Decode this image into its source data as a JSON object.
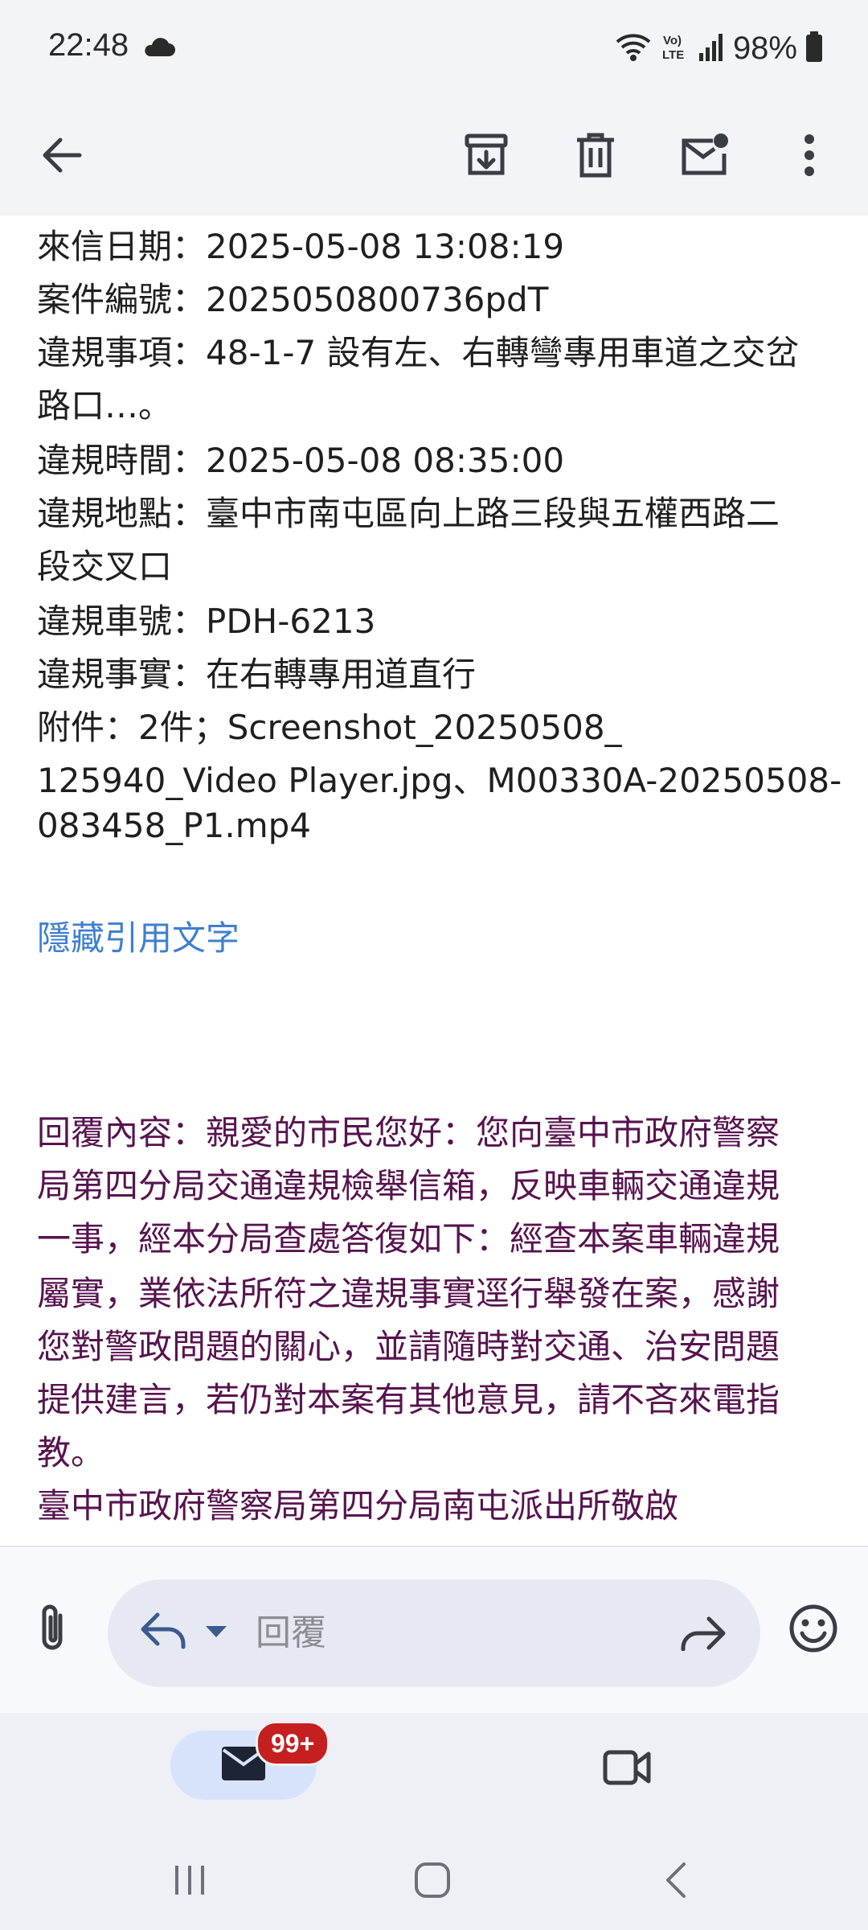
{
  "status_bar": {
    "time": "22:48",
    "battery": "98%",
    "icons": [
      "cloud-icon",
      "wifi-icon",
      "volte-icon",
      "signal-icon",
      "battery-icon"
    ]
  },
  "toolbar": {
    "icons": [
      "back-arrow-icon",
      "archive-icon",
      "delete-icon",
      "mark-unread-icon",
      "more-vert-icon"
    ]
  },
  "email": {
    "lines": [
      "來信日期：2025-05-08 13:08:19",
      "案件編號：2025050800736pdT",
      "違規事項：48-1-7 設有左、右轉彎專用車道之交岔",
      "路口…。",
      "違規時間：2025-05-08 08:35:00",
      "違規地點：臺中市南屯區向上路三段與五權西路二",
      "段交叉口",
      "違規車號：PDH-6213",
      "違規事實：在右轉專用道直行",
      "附件：2件；Screenshot_20250508_",
      "125940_Video Player.jpg、M00330A-20250508-",
      "083458_P1.mp4"
    ],
    "hide_quoted_text": "隱藏引用文字",
    "reply_lines": [
      "回覆內容：親愛的市民您好：您向臺中市政府警察",
      "局第四分局交通違規檢舉信箱，反映車輛交通違規",
      "一事，經本分局查處答復如下：經查本案車輛違規",
      "屬實，業依法所符之違規事實逕行舉發在案，感謝",
      "您對警政問題的關心，並請隨時對交通、治安問題",
      "提供建言，若仍對本案有其他意見，請不吝來電指",
      "教。"
    ],
    "signature": "臺中市政府警察局第四分局南屯派出所敬啟"
  },
  "compose": {
    "placeholder": "回覆",
    "icons": [
      "attach-icon",
      "reply-icon",
      "reply-options-caret-icon",
      "forward-icon",
      "emoji-icon"
    ]
  },
  "bottom_nav": {
    "mail_badge": "99+",
    "icons": [
      "mail-icon",
      "meet-video-icon"
    ]
  },
  "system_nav": {
    "icons": [
      "recents-icon",
      "home-icon",
      "back-icon"
    ]
  },
  "colors": {
    "link": "#3f7fd1",
    "reply_text": "#58134f",
    "badge": "#c51f1f",
    "mail_tab": "#d7e3fb"
  }
}
